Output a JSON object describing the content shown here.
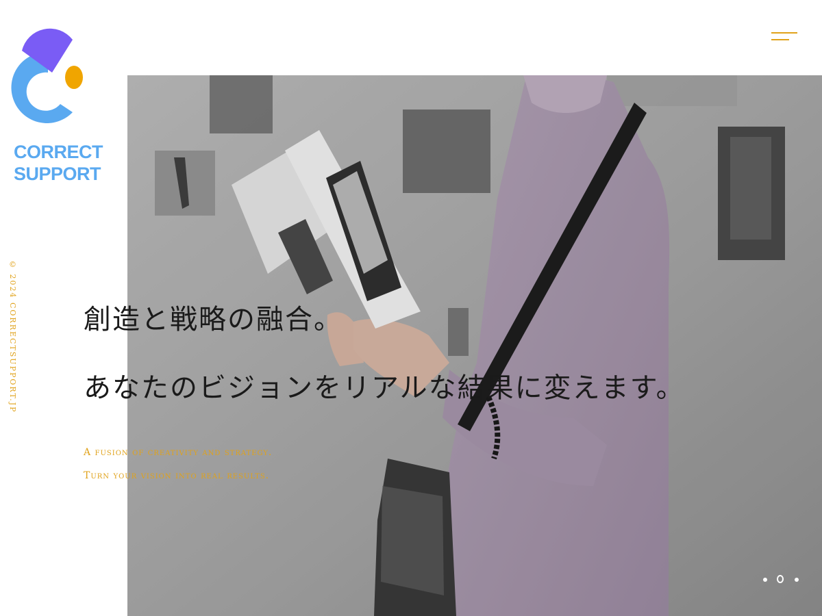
{
  "logo": {
    "line1": "CORRECT",
    "line2": "SUPPORT",
    "colors": {
      "purple": "#7a5cf5",
      "blue": "#5aa9f0",
      "orange": "#f0a500"
    }
  },
  "menu": {
    "icon": "hamburger-menu-icon",
    "color": "#e0a21a"
  },
  "copyright": "© 2024 CORRECTSUPPORT.JP",
  "hero": {
    "headline_line1": "創造と戦略の融合。",
    "headline_line2": "あなたのビジョンをリアルな結果に変えます。",
    "subline1": "A fusion of creativity and strategy.",
    "subline2": "Turn your vision into real results.",
    "accent_color": "#e0a21a"
  },
  "slider": {
    "count": 3,
    "active": 2
  }
}
